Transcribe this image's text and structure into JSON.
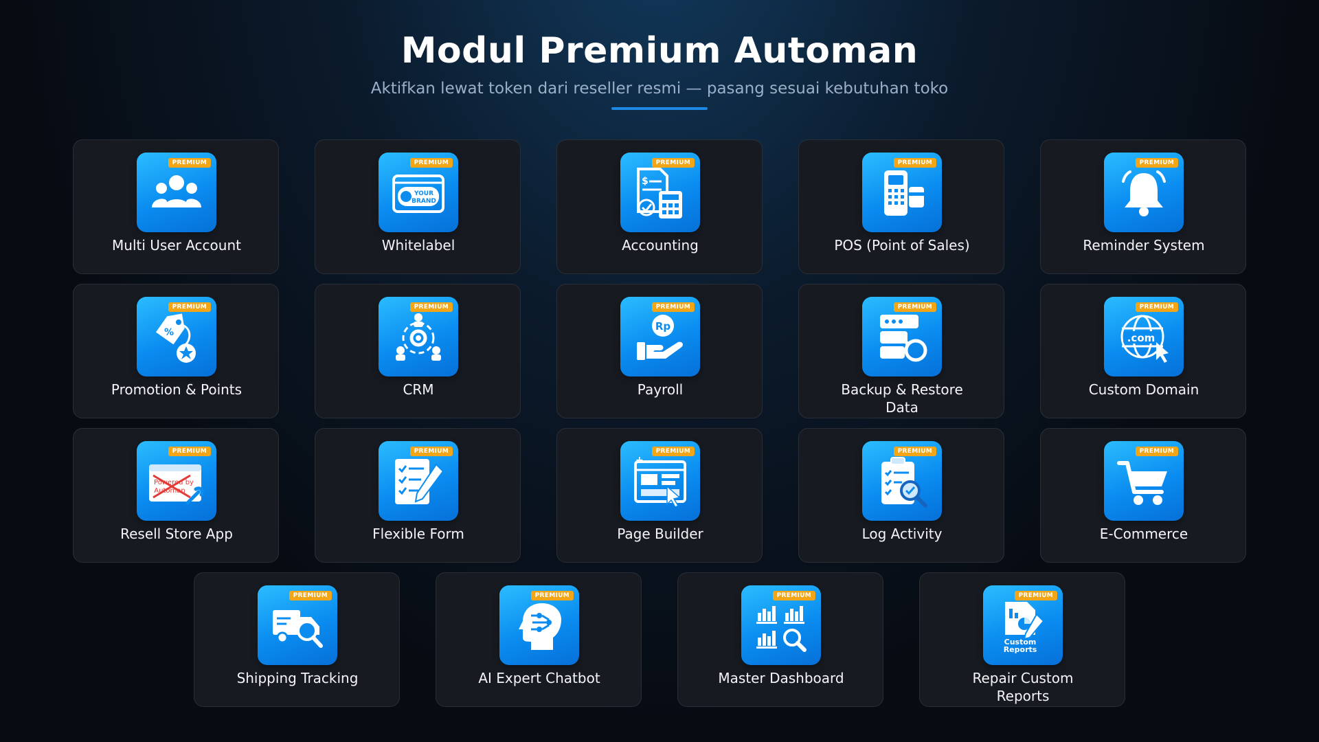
{
  "header": {
    "title": "Modul Premium Automan",
    "subtitle": "Aktifkan lewat token dari reseller resmi — pasang sesuai kebutuhan toko"
  },
  "colors": {
    "accent": "#1e88e5",
    "icon_gradient_top": "#2bbcff",
    "icon_gradient_bottom": "#0670d8",
    "badge": "#f2a516",
    "card_background": "#171b21"
  },
  "modules": [
    {
      "label": "Multi User Account",
      "badge": "PREMIUM",
      "icon": "users-icon"
    },
    {
      "label": "Whitelabel",
      "badge": "PREMIUM",
      "icon": "your-brand-icon"
    },
    {
      "label": "Accounting",
      "badge": "PREMIUM",
      "icon": "calculator-document-icon"
    },
    {
      "label": "POS (Point of Sales)",
      "badge": "PREMIUM",
      "icon": "pos-terminal-icon"
    },
    {
      "label": "Reminder System",
      "badge": "PREMIUM",
      "icon": "bell-icon"
    },
    {
      "label": "Promotion & Points",
      "badge": "PREMIUM",
      "icon": "price-tag-icon"
    },
    {
      "label": "CRM",
      "badge": "PREMIUM",
      "icon": "crm-network-icon"
    },
    {
      "label": "Payroll",
      "badge": "PREMIUM",
      "icon": "hand-coin-icon"
    },
    {
      "label": "Backup & Restore Data",
      "badge": "PREMIUM",
      "icon": "server-restore-icon"
    },
    {
      "label": "Custom Domain",
      "badge": "PREMIUM",
      "icon": "globe-com-icon"
    },
    {
      "label": "Resell Store App",
      "badge": "PREMIUM",
      "icon": "powered-by-crossed-icon"
    },
    {
      "label": "Flexible Form",
      "badge": "PREMIUM",
      "icon": "form-pencil-icon"
    },
    {
      "label": "Page Builder",
      "badge": "PREMIUM",
      "icon": "page-layout-icon"
    },
    {
      "label": "Log Activity",
      "badge": "PREMIUM",
      "icon": "clipboard-search-icon"
    },
    {
      "label": "E-Commerce",
      "badge": "PREMIUM",
      "icon": "shopping-cart-icon"
    },
    {
      "label": "Shipping Tracking",
      "badge": "PREMIUM",
      "icon": "truck-search-icon"
    },
    {
      "label": "AI Expert Chatbot",
      "badge": "PREMIUM",
      "icon": "ai-head-icon"
    },
    {
      "label": "Master Dashboard",
      "badge": "PREMIUM",
      "icon": "charts-search-icon"
    },
    {
      "label": "Repair Custom Reports",
      "badge": "PREMIUM",
      "icon": "custom-reports-icon"
    }
  ],
  "icon_text": {
    "your_brand_line1": "YOUR",
    "your_brand_line2": "BRAND",
    "powered_by_line1": "Powered by",
    "powered_by_line2": "Automan",
    "payroll_currency": "Rp",
    "custom_domain": ".com",
    "custom_reports_line1": "Custom",
    "custom_reports_line2": "Reports"
  }
}
